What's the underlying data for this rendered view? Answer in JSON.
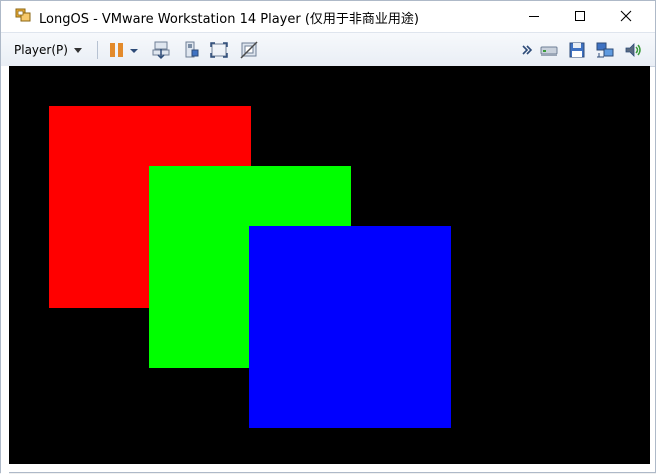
{
  "window": {
    "title": "LongOS - VMware Workstation 14 Player (仅用于非商业用途)"
  },
  "toolbar": {
    "player_menu_label": "Player(P)"
  },
  "icons": {
    "app": "vmware-app-icon",
    "pause": "pause-icon",
    "pause_dropdown": "chevron-down-icon",
    "send_ctrl_alt_del": "send-keys-icon",
    "removable_devices": "devices-icon",
    "fullscreen": "fullscreen-icon",
    "unity": "unity-icon",
    "more": "double-chevron-right-icon",
    "hdd": "hard-disk-icon",
    "floppy": "floppy-icon",
    "network": "network-icon",
    "audio": "audio-icon"
  },
  "guest_screen": {
    "squares": [
      {
        "name": "red-square",
        "color": "#ff0000"
      },
      {
        "name": "green-square",
        "color": "#00ff00"
      },
      {
        "name": "blue-square",
        "color": "#0000ff"
      }
    ]
  }
}
